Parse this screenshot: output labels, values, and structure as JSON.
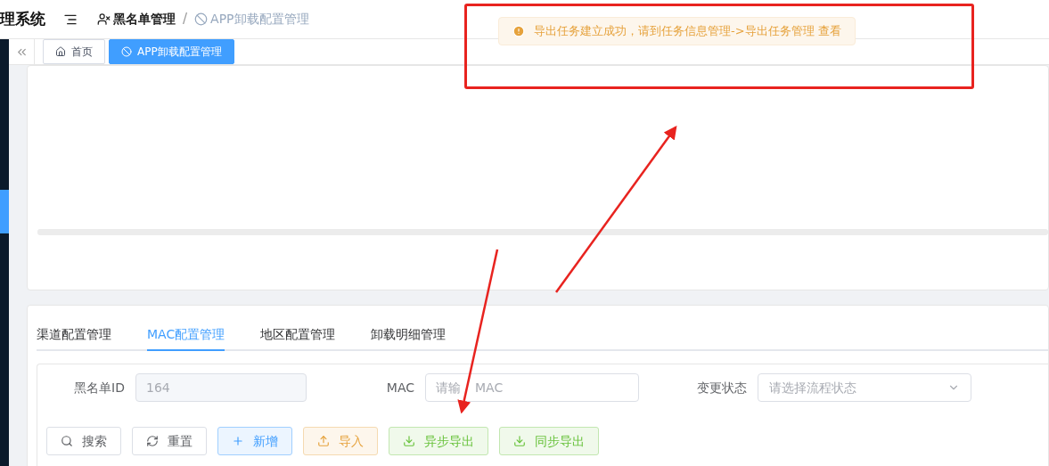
{
  "header": {
    "title": "理系统",
    "separator": "/",
    "breadcrumb": [
      {
        "text": "黑名单管理",
        "current": false
      },
      {
        "text": "APP卸载配置管理",
        "current": true
      }
    ]
  },
  "toast": {
    "message": "导出任务建立成功，请到任务信息管理->导出任务管理 查看"
  },
  "page_tabs": [
    {
      "label": "首页",
      "kind": "home",
      "selected": false
    },
    {
      "label": "APP卸载配置管理",
      "kind": "route",
      "selected": true
    }
  ],
  "section_tabs": [
    {
      "label": "渠道配置管理",
      "selected": false
    },
    {
      "label": "MAC配置管理",
      "selected": true
    },
    {
      "label": "地区配置管理",
      "selected": false
    },
    {
      "label": "卸载明细管理",
      "selected": false
    }
  ],
  "form": {
    "fields": [
      {
        "kind": "input",
        "label": "黑名单ID",
        "value": "164",
        "disabled": true
      },
      {
        "kind": "input",
        "label": "MAC",
        "placeholder_parts": [
          "请输",
          "MAC"
        ]
      },
      {
        "kind": "select",
        "label": "变更状态",
        "placeholder": "请选择流程状态"
      }
    ]
  },
  "buttons": [
    {
      "label": "搜索",
      "kind": "search"
    },
    {
      "label": "重置",
      "kind": "reset"
    },
    {
      "label": "新增",
      "kind": "create"
    },
    {
      "label": "导入",
      "kind": "import"
    },
    {
      "label": "异步导出",
      "kind": "export"
    },
    {
      "label": "同步导出",
      "kind": "export"
    }
  ]
}
